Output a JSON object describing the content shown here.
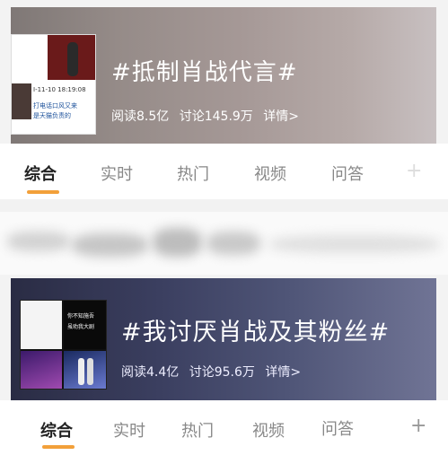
{
  "topic1": {
    "title": "#抵制肖战代言#",
    "read_label": "阅读8.5亿",
    "discuss_label": "讨论145.9万",
    "detail_label": "详情>",
    "thumb_caption": "I-11-10 18:19:08",
    "thumb_line1": "打电话口风又来",
    "thumb_line2": "是天猫负责的"
  },
  "tabs1": [
    "综合",
    "实时",
    "热门",
    "视频",
    "问答"
  ],
  "topic2": {
    "title": "#我讨厌肖战及其粉丝#",
    "read_label": "阅读4.4亿",
    "discuss_label": "讨论95.6万",
    "detail_label": "详情>",
    "thumb_line1": "你不知施吾",
    "thumb_line2": "虽劝我大剧"
  },
  "tabs2": [
    "综合",
    "实时",
    "热门",
    "视频",
    "问答"
  ],
  "tabs2_plus": "+",
  "colors": {
    "accent": "#f2a03a"
  }
}
